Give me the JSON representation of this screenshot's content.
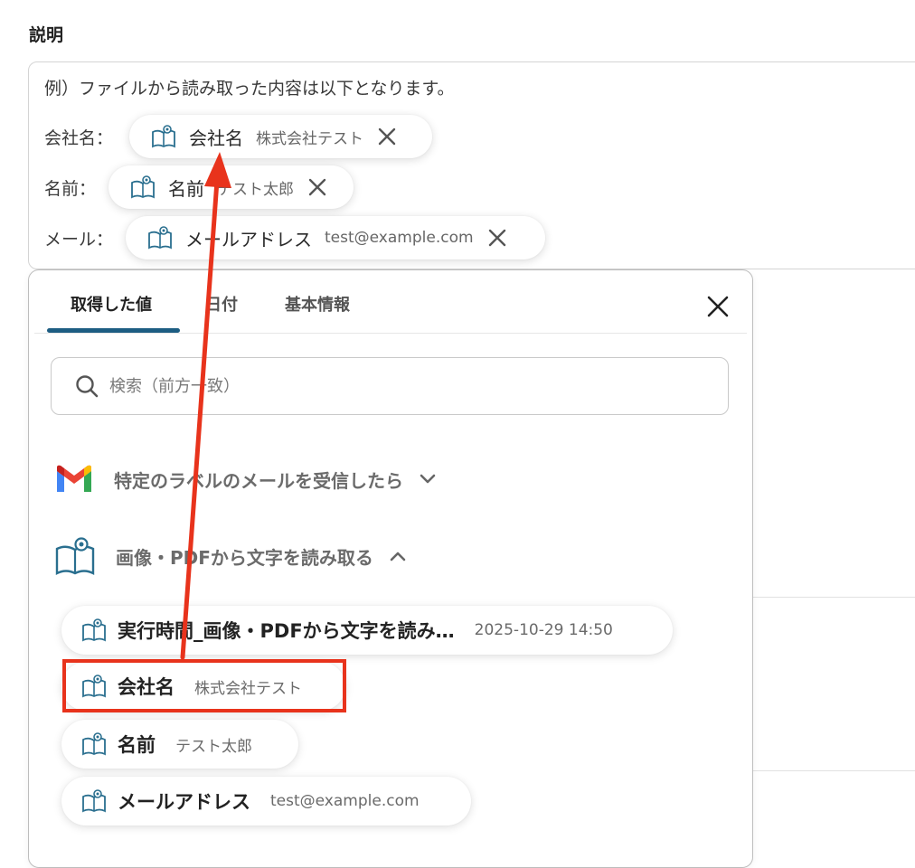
{
  "section": {
    "title": "説明"
  },
  "description": {
    "intro": "例）ファイルから読み取った内容は以下となります。",
    "rows": [
      {
        "label": "会社名：",
        "chip_name": "会社名",
        "chip_value": "株式会社テスト"
      },
      {
        "label": "名前：",
        "chip_name": "名前",
        "chip_value": "テスト太郎"
      },
      {
        "label": "メール：",
        "chip_name": "メールアドレス",
        "chip_value": "test@example.com"
      }
    ]
  },
  "popup": {
    "tabs": [
      {
        "label": "取得した値",
        "active": true
      },
      {
        "label": "日付",
        "active": false
      },
      {
        "label": "基本情報",
        "active": false
      }
    ],
    "search": {
      "placeholder": "検索（前方一致）",
      "value": ""
    },
    "groups": [
      {
        "label": "特定のラベルのメールを受信したら",
        "icon": "gmail-icon",
        "expanded": false
      },
      {
        "label": "画像・PDFから文字を読み取る",
        "icon": "ocr-book-icon",
        "expanded": true
      }
    ],
    "items": [
      {
        "name": "実行時間_画像・PDFから文字を読み…",
        "value": "2025-10-29 14:50"
      },
      {
        "name": "会社名",
        "value": "株式会社テスト"
      },
      {
        "name": "名前",
        "value": "テスト太郎"
      },
      {
        "name": "メールアドレス",
        "value": "test@example.com"
      }
    ]
  },
  "colors": {
    "accent": "#1d5d82",
    "icon": "#2a6f8f",
    "annotation": "#e8331c"
  }
}
